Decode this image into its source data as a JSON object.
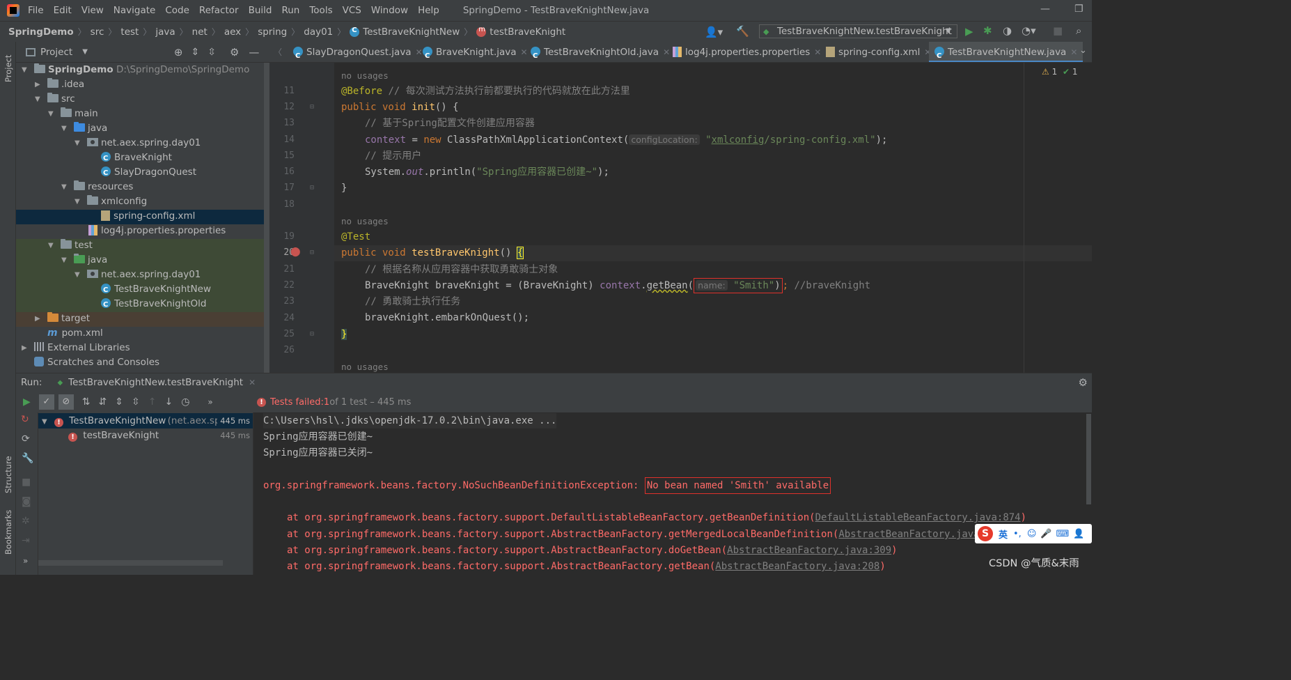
{
  "menubar": {
    "items": [
      "File",
      "Edit",
      "View",
      "Navigate",
      "Code",
      "Refactor",
      "Build",
      "Run",
      "Tools",
      "VCS",
      "Window",
      "Help"
    ],
    "window_title": "SpringDemo - TestBraveKnightNew.java"
  },
  "breadcrumb": {
    "items": [
      "SpringDemo",
      "src",
      "test",
      "java",
      "net",
      "aex",
      "spring",
      "day01"
    ],
    "class_name": "TestBraveKnightNew",
    "method_name": "testBraveKnight"
  },
  "toolbar": {
    "run_config": "TestBraveKnightNew.testBraveKnight"
  },
  "left_strip": {
    "project": "Project",
    "structure": "Structure",
    "bookmarks": "Bookmarks"
  },
  "project": {
    "header": "Project",
    "tree": [
      {
        "label": "SpringDemo",
        "path": "D:\\SpringDemo\\SpringDemo"
      },
      {
        "label": ".idea"
      },
      {
        "label": "src"
      },
      {
        "label": "main"
      },
      {
        "label": "java"
      },
      {
        "label": "net.aex.spring.day01"
      },
      {
        "label": "BraveKnight"
      },
      {
        "label": "SlayDragonQuest"
      },
      {
        "label": "resources"
      },
      {
        "label": "xmlconfig"
      },
      {
        "label": "spring-config.xml"
      },
      {
        "label": "log4j.properties.properties"
      },
      {
        "label": "test"
      },
      {
        "label": "java"
      },
      {
        "label": "net.aex.spring.day01"
      },
      {
        "label": "TestBraveKnightNew"
      },
      {
        "label": "TestBraveKnightOld"
      },
      {
        "label": "target"
      },
      {
        "label": "pom.xml"
      },
      {
        "label": "External Libraries"
      },
      {
        "label": "Scratches and Consoles"
      }
    ]
  },
  "tabs": [
    "SlayDragonQuest.java",
    "BraveKnight.java",
    "TestBraveKnightOld.java",
    "log4j.properties.properties",
    "spring-config.xml",
    "TestBraveKnightNew.java"
  ],
  "editor": {
    "warnings": "1",
    "ok": "1",
    "no_usages": "no usages",
    "lines": [
      "11",
      "12",
      "13",
      "14",
      "15",
      "16",
      "17",
      "18",
      "19",
      "20",
      "21",
      "22",
      "23",
      "24",
      "25",
      "26"
    ],
    "code": {
      "l11_ann": "@Before",
      "l11_cm": " // 每次测试方法执行前都要执行的代码就放在此方法里",
      "l12_kw": "public void ",
      "l12_fn": "init",
      "l12_rest": "() {",
      "l13": "// 基于Spring配置文件创建应用容器",
      "l14_fld": "context",
      "l14_eq": " = ",
      "l14_kw": "new ",
      "l14_cls": "ClassPathXmlApplicationContext(",
      "l14_hint": "configLocation:",
      "l14_q1": "\"",
      "l14_str_u": "xmlconfig",
      "l14_str": "/spring-config.xml\"",
      "l14_end": ");",
      "l15": "// 提示用户",
      "l16_a": "System.",
      "l16_out": "out",
      "l16_b": ".println(",
      "l16_str": "\"Spring应用容器已创建~\"",
      "l16_end": ");",
      "l17": "}",
      "l19_ann": "@Test",
      "l20_kw": "public void ",
      "l20_fn": "testBraveKnight",
      "l20_rest": "() ",
      "l20_brace": "{",
      "l21": "// 根据名称从应用容器中获取勇敢骑士对象",
      "l22_a": "BraveKnight braveKnight = (BraveKnight) ",
      "l22_fld": "context",
      "l22_dot": ".",
      "l22_getbean": "getBean",
      "l22_paren": "(",
      "l22_hint": "name:",
      "l22_str": "\"Smith\"",
      "l22_close": ")",
      "l22_semi": "; ",
      "l22_cm": "//braveKnight",
      "l23": "// 勇敢骑士执行任务",
      "l24": "braveKnight.embarkOnQuest();",
      "l25": "}"
    }
  },
  "run": {
    "label": "Run:",
    "tab": "TestBraveKnightNew.testBraveKnight",
    "status_prefix": "Tests failed: ",
    "status_count": "1",
    "status_rest": " of 1 test – 445 ms",
    "tree": [
      {
        "label": "TestBraveKnightNew",
        "pkg": "(net.aex.spring",
        "time": "445 ms"
      },
      {
        "label": "testBraveKnight",
        "time": "445 ms"
      }
    ],
    "console": {
      "l1": "C:\\Users\\hsl\\.jdks\\openjdk-17.0.2\\bin\\java.exe ...",
      "l2": "Spring应用容器已创建~",
      "l3": "Spring应用容器已关闭~",
      "exc": "org.springframework.beans.factory.NoSuchBeanDefinitionException: ",
      "exc_msg": "No bean named 'Smith' available",
      "st1_a": "at org.springframework.beans.factory.support.DefaultListableBeanFactory.getBeanDefinition(",
      "st1_link": "DefaultListableBeanFactory.java:874",
      "st1_end": ")",
      "st2_a": "at org.springframework.beans.factory.support.AbstractBeanFactory.getMergedLocalBeanDefinition(",
      "st2_link": "AbstractBeanFactory.java",
      "st3_a": "at org.springframework.beans.factory.support.AbstractBeanFactory.doGetBean(",
      "st3_link": "AbstractBeanFactory.java:309",
      "st3_end": ")",
      "st4_a": "at org.springframework.beans.factory.support.AbstractBeanFactory.getBean(",
      "st4_link": "AbstractBeanFactory.java:208",
      "st4_end": ")"
    }
  },
  "ime": {
    "lang": "英"
  },
  "watermark": "CSDN @气质&末雨",
  "colors": {
    "error_red": "#ff6b68",
    "box_red": "#e0312b",
    "accent_blue": "#4a88c7",
    "green_run": "#499c54"
  }
}
